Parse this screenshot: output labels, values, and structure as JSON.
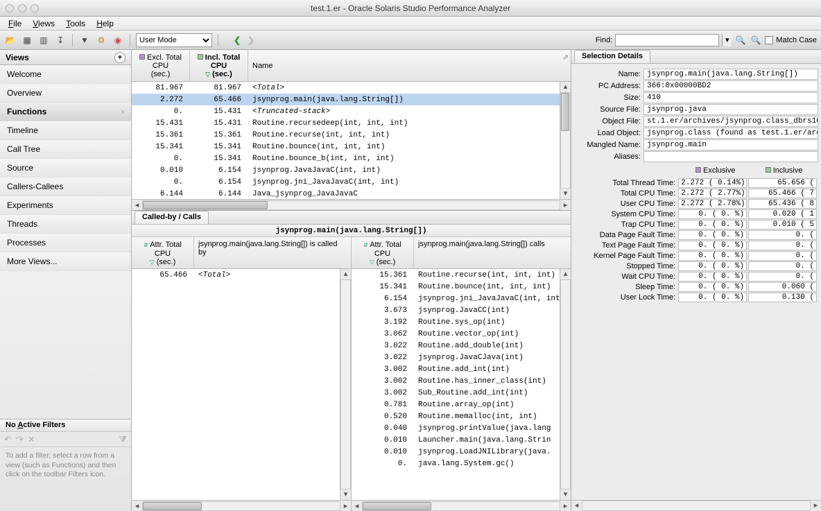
{
  "window_title": "test.1.er  -  Oracle Solaris Studio Performance Analyzer",
  "menubar": [
    "File",
    "Views",
    "Tools",
    "Help"
  ],
  "toolbar": {
    "mode_label": "User Mode",
    "find_label": "Find:",
    "find_value": "",
    "match_case": "Match Case"
  },
  "sidebar": {
    "title": "Views",
    "items": [
      {
        "label": "Welcome"
      },
      {
        "label": "Overview"
      },
      {
        "label": "Functions",
        "selected": true
      },
      {
        "label": "Timeline"
      },
      {
        "label": "Call Tree"
      },
      {
        "label": "Source"
      },
      {
        "label": "Callers-Callees"
      },
      {
        "label": "Experiments"
      },
      {
        "label": "Threads"
      },
      {
        "label": "Processes"
      },
      {
        "label": "More Views..."
      }
    ],
    "filters_title": "No Active Filters",
    "filters_hint": "To add a filter, select a row from a view (such as Functions) and then click on the toolbar Filters icon."
  },
  "functions": {
    "col1": "Excl. Total\nCPU",
    "col1_unit": "(sec.)",
    "col2": "Incl. Total\nCPU",
    "col2_unit": "(sec.)",
    "col3": "Name",
    "rows": [
      {
        "excl": "81.967",
        "incl": "81.967",
        "name": "<Total>",
        "italic": true
      },
      {
        "excl": "2.272",
        "incl": "65.466",
        "name": "jsynprog.main(java.lang.String[])",
        "sel": true
      },
      {
        "excl": "0.",
        "incl": "15.431",
        "name": "<Truncated-stack>",
        "italic": true
      },
      {
        "excl": "15.431",
        "incl": "15.431",
        "name": "Routine.recursedeep(int, int, int)"
      },
      {
        "excl": "15.361",
        "incl": "15.361",
        "name": "Routine.recurse(int, int, int)"
      },
      {
        "excl": "15.341",
        "incl": "15.341",
        "name": "Routine.bounce(int, int, int)"
      },
      {
        "excl": "0.",
        "incl": "15.341",
        "name": "Routine.bounce_b(int, int, int)"
      },
      {
        "excl": "0.010",
        "incl": "6.154",
        "name": "jsynprog.JavaJavaC(int, int)"
      },
      {
        "excl": "0.",
        "incl": "6.154",
        "name": "jsynprog.jni_JavaJavaC(int, int)"
      },
      {
        "excl": "6.144",
        "incl": "6.144",
        "name": "Java_jsynprog_JavaJavaC"
      }
    ]
  },
  "called_tab": "Called-by / Calls",
  "called_header": "jsynprog.main(java.lang.String[])",
  "called_by": {
    "attr_label": "Attr. Total\nCPU",
    "attr_unit": "(sec.)",
    "name_label": "jsynprog.main(java.lang.String[]) is called by",
    "rows": [
      {
        "a": "65.466",
        "n": "<Total>",
        "italic": true
      }
    ]
  },
  "calls": {
    "attr_label": "Attr. Total\nCPU",
    "attr_unit": "(sec.)",
    "name_label": "jsynprog.main(java.lang.String[]) calls",
    "rows": [
      {
        "a": "15.361",
        "n": "Routine.recurse(int, int, int)"
      },
      {
        "a": "15.341",
        "n": "Routine.bounce(int, int, int)"
      },
      {
        "a": "6.154",
        "n": "jsynprog.jni_JavaJavaC(int, int)"
      },
      {
        "a": "3.673",
        "n": "jsynprog.JavaCC(int)"
      },
      {
        "a": "3.192",
        "n": "Routine.sys_op(int)"
      },
      {
        "a": "3.062",
        "n": "Routine.vector_op(int)"
      },
      {
        "a": "3.022",
        "n": "Routine.add_double(int)"
      },
      {
        "a": "3.022",
        "n": "jsynprog.JavaCJava(int)"
      },
      {
        "a": "3.002",
        "n": "Routine.add_int(int)"
      },
      {
        "a": "3.002",
        "n": "Routine.has_inner_class(int)"
      },
      {
        "a": "3.002",
        "n": "Sub_Routine.add_int(int)"
      },
      {
        "a": "0.781",
        "n": "Routine.array_op(int)"
      },
      {
        "a": "0.520",
        "n": "Routine.memalloc(int, int)"
      },
      {
        "a": "0.040",
        "n": "jsynprog.printValue(java.lang"
      },
      {
        "a": "0.010",
        "n": "Launcher.main(java.lang.Strin"
      },
      {
        "a": "0.010",
        "n": "jsynprog.LoadJNILibrary(java."
      },
      {
        "a": "0.",
        "n": "java.lang.System.gc()"
      }
    ]
  },
  "selection": {
    "tab": "Selection Details",
    "fields": [
      {
        "l": "Name:",
        "v": "jsynprog.main(java.lang.String[])"
      },
      {
        "l": "PC Address:",
        "v": "366:0x00000BD2"
      },
      {
        "l": "Size:",
        "v": "410"
      },
      {
        "l": "Source File:",
        "v": "jsynprog.java"
      },
      {
        "l": "Object File:",
        "v": "st.1.er/archives/jsynprog.class_dbrs10"
      },
      {
        "l": "Load Object:",
        "v": "jsynprog.class (found as test.1.er/arc"
      },
      {
        "l": "Mangled Name:",
        "v": "jsynprog.main"
      },
      {
        "l": "Aliases:",
        "v": ""
      }
    ],
    "metric_head": {
      "excl": "Exclusive",
      "incl": "Inclusive"
    },
    "metrics": [
      {
        "l": "Total Thread Time:",
        "e": "2.272 (  0.14%)",
        "i": "65.656  ("
      },
      {
        "l": "Total CPU Time:",
        "e": "2.272 (  2.77%)",
        "i": "65.466  ( 7"
      },
      {
        "l": "User CPU Time:",
        "e": "2.272 (  2.78%)",
        "i": "65.436  ( 8"
      },
      {
        "l": "System CPU Time:",
        "e": "0.    (  0.  %)",
        "i": "0.020  ( 1"
      },
      {
        "l": "Trap CPU Time:",
        "e": "0.    (  0.  %)",
        "i": "0.010  ( 5"
      },
      {
        "l": "Data Page Fault Time:",
        "e": "0.    (  0.  %)",
        "i": "0.     ("
      },
      {
        "l": "Text Page Fault Time:",
        "e": "0.    (  0.  %)",
        "i": "0.     ("
      },
      {
        "l": "Kernel Page Fault Time:",
        "e": "0.    (  0.  %)",
        "i": "0.     ("
      },
      {
        "l": "Stopped Time:",
        "e": "0.    (  0.  %)",
        "i": "0.     ("
      },
      {
        "l": "Wait CPU Time:",
        "e": "0.    (  0.  %)",
        "i": "0.     ("
      },
      {
        "l": "Sleep Time:",
        "e": "0.    (  0.  %)",
        "i": "0.060  ("
      },
      {
        "l": "User Lock Time:",
        "e": "0.    (  0.  %)",
        "i": "0.130  ("
      }
    ]
  }
}
